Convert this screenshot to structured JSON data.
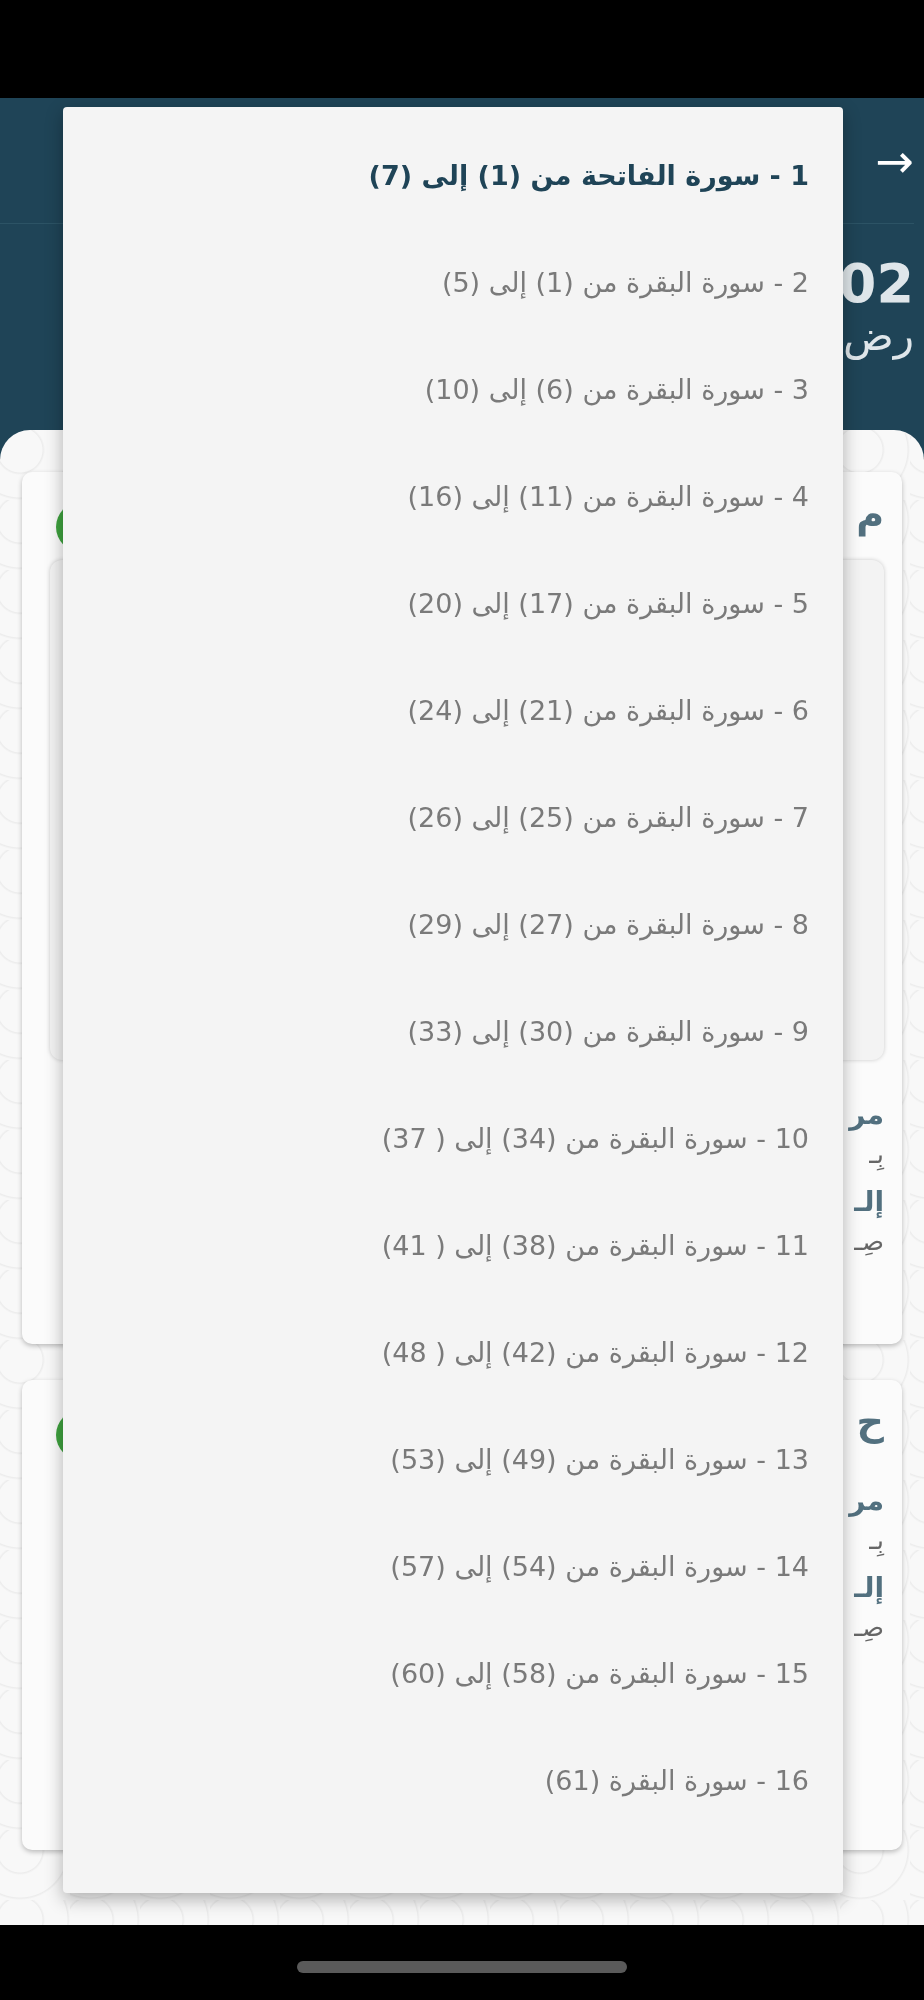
{
  "header": {
    "back_icon": "→",
    "title_fragment": "02",
    "subtitle_fragment": "رض"
  },
  "cards": [
    {
      "heading": "م",
      "lines": [
        {
          "kind": "label",
          "text": "مر"
        },
        {
          "kind": "verse",
          "text": "بِـ"
        },
        {
          "kind": "label",
          "text": "إلـ"
        },
        {
          "kind": "verse",
          "text": "صِـ"
        }
      ],
      "has_inner_box": true
    },
    {
      "heading": "ح",
      "lines": [
        {
          "kind": "label",
          "text": "مر"
        },
        {
          "kind": "verse",
          "text": "بِـ"
        },
        {
          "kind": "label",
          "text": "إلـ"
        },
        {
          "kind": "verse",
          "text": "صِـ"
        }
      ],
      "has_inner_box": false
    }
  ],
  "menu": {
    "items": [
      {
        "label": "1 - سورة الفاتحة من (1) إلى (7)",
        "selected": true
      },
      {
        "label": "2 - سورة البقرة من (1) إلى (5)",
        "selected": false
      },
      {
        "label": "3 - سورة البقرة من (6) إلى (10)",
        "selected": false
      },
      {
        "label": "4 - سورة البقرة من (11) إلى (16)",
        "selected": false
      },
      {
        "label": "5 - سورة البقرة من (17) إلى (20)",
        "selected": false
      },
      {
        "label": "6 - سورة البقرة من (21) إلى (24)",
        "selected": false
      },
      {
        "label": "7 - سورة البقرة من (25) إلى (26)",
        "selected": false
      },
      {
        "label": "8 - سورة البقرة من (27) إلى (29)",
        "selected": false
      },
      {
        "label": "9 - سورة البقرة من (30) إلى (33)",
        "selected": false
      },
      {
        "label": "10 - سورة البقرة من (34) إلى ( 37)",
        "selected": false
      },
      {
        "label": "11 - سورة البقرة من (38) إلى ( 41)",
        "selected": false
      },
      {
        "label": "12 - سورة البقرة من (42) إلى ( 48)",
        "selected": false
      },
      {
        "label": "13 - سورة البقرة من (49) إلى (53)",
        "selected": false
      },
      {
        "label": "14 - سورة البقرة من (54) إلى (57)",
        "selected": false
      },
      {
        "label": "15 - سورة البقرة من (58) إلى (60)",
        "selected": false
      },
      {
        "label": "16 - سورة البقرة (61)",
        "selected": false
      }
    ]
  }
}
